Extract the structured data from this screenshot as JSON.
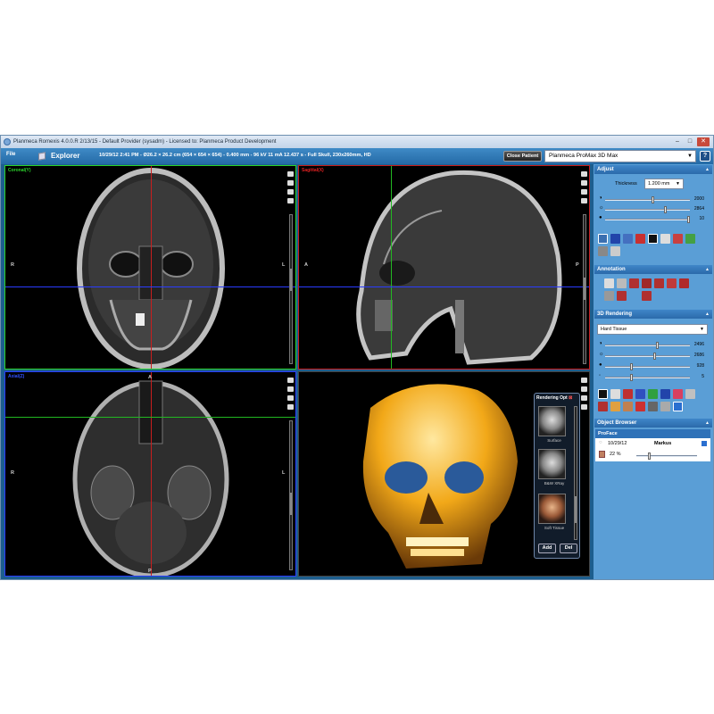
{
  "window": {
    "title": "Planmeca Romexis 4.0.0.R  2/13/15 - Default Provider (sysadm) - Licensed to: Planmeca Product Development",
    "controls": [
      "–",
      "□",
      "✕"
    ]
  },
  "toolbar": {
    "file_label": "File",
    "module_label": "Explorer",
    "study_info": "10/29/12 2:41 PM - Ø26.2 × 26.2 cm (654 × 654 × 654) - 0.400 mm - 96 kV 11 mA 12.437 s - Full Skull, 230x260mm, HD",
    "close_patient_label": "Close Patient",
    "device_selected": "Planmeca ProMax 3D Max",
    "help_label": "?"
  },
  "views": {
    "coronal": {
      "label": "Coronal(Y)",
      "label_color": "#2bd42b",
      "left": "R",
      "right": "L"
    },
    "sagittal": {
      "label": "Sagittal(X)",
      "label_color": "#e02020",
      "left": "A",
      "right": "P"
    },
    "axial": {
      "label": "Axial(Z)",
      "label_color": "#3050ff",
      "top": "A",
      "bottom": "P",
      "left": "R",
      "right": "L"
    }
  },
  "rendering_options": {
    "title": "Rendering Opt",
    "presets": [
      {
        "label": "Surface"
      },
      {
        "label": "B&W XRay"
      },
      {
        "label": "Soft Tissue"
      }
    ],
    "add_label": "Add",
    "del_label": "Del"
  },
  "panel": {
    "adjust": {
      "title": "Adjust",
      "thickness_label": "Thickness",
      "thickness_value": "1.200 mm",
      "sliders": [
        {
          "icon": "contrast-icon",
          "value": "2000",
          "level": 0.55
        },
        {
          "icon": "brightness-icon",
          "value": "2864",
          "level": 0.7
        },
        {
          "icon": "gamma-icon",
          "value": "10",
          "level": 0.98
        }
      ]
    },
    "annotation": {
      "title": "Annotation"
    },
    "rendering": {
      "title": "3D Rendering",
      "preset_value": "Hard Tissue",
      "sliders": [
        {
          "icon": "contrast-icon",
          "value": "2496",
          "level": 0.6
        },
        {
          "icon": "brightness-icon",
          "value": "2686",
          "level": 0.57
        },
        {
          "icon": "gamma-icon",
          "value": "928",
          "level": 0.3
        },
        {
          "icon": "opacity-icon",
          "value": "5",
          "level": 0.3
        }
      ]
    },
    "object_browser": {
      "title": "Object Browser",
      "group": "ProFace",
      "rows": [
        {
          "date": "10/29/12",
          "name": "Markus"
        },
        {
          "opacity": "22 %",
          "level": 0.2
        }
      ]
    }
  },
  "colors": {
    "toolbar": "#2d76b5",
    "panel": "#5a9ed6",
    "crosshair_red": "#c81e1e",
    "crosshair_green": "#22b822",
    "crosshair_blue": "#2a3cff"
  }
}
